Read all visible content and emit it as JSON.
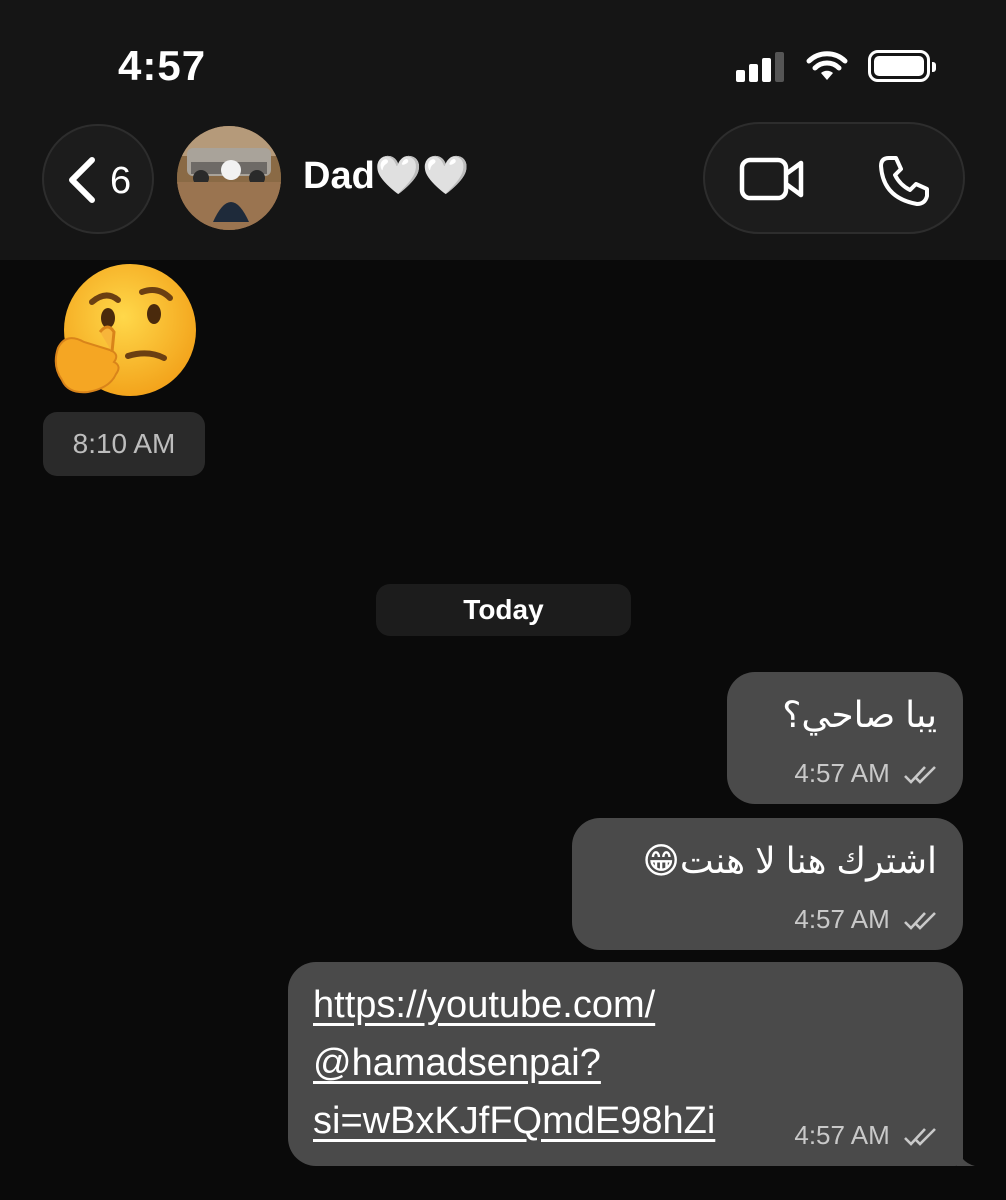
{
  "status_bar": {
    "time": "4:57",
    "signal_bars_active": 3,
    "signal_bars_total": 4
  },
  "header": {
    "back_count": "6",
    "contact_name": "Dad🤍🤍",
    "icons": [
      "chevron-left-icon",
      "video-camera-icon",
      "phone-icon"
    ]
  },
  "messages": {
    "received_emoji": "🤔",
    "received_time": "8:10 AM",
    "day_separator": "Today",
    "sent": [
      {
        "text": "يبا صاحي؟",
        "time": "4:57 AM"
      },
      {
        "text": "اشترك هنا لا هنت😁",
        "time": "4:57 AM"
      },
      {
        "link_lines": [
          "https://youtube.com/",
          "@hamadsenpai?",
          "si=wBxKJfFQmdE98hZi"
        ],
        "time": "4:57 AM"
      }
    ]
  },
  "colors": {
    "background": "#0a0a0a",
    "header": "#151515",
    "sent_bubble": "#4a4a4a",
    "pill": "#2a2a2a"
  }
}
